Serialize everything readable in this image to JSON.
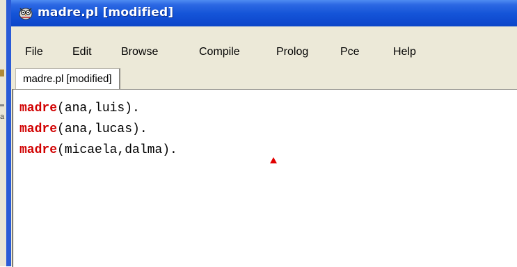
{
  "window": {
    "title": "madre.pl [modified]",
    "accent": "#1555d8"
  },
  "menu": {
    "items": [
      {
        "label": "File"
      },
      {
        "label": "Edit"
      },
      {
        "label": "Browse"
      },
      {
        "label": "Compile"
      },
      {
        "label": "Prolog"
      },
      {
        "label": "Pce"
      },
      {
        "label": "Help"
      }
    ]
  },
  "tabs": [
    {
      "label": "madre.pl [modified]"
    }
  ],
  "editor": {
    "lines": [
      {
        "functor": "madre",
        "args": "(ana,luis)."
      },
      {
        "functor": "madre",
        "args": "(ana,lucas)."
      },
      {
        "functor": "madre",
        "args": "(micaela,dalma)."
      }
    ],
    "keyword_color": "#d10000",
    "caret_color": "#e10000"
  },
  "icons": {
    "app_icon": "swi-prolog-owl-icon",
    "caret": "caret-marker-icon"
  },
  "background_window": {
    "glyph": "a"
  }
}
